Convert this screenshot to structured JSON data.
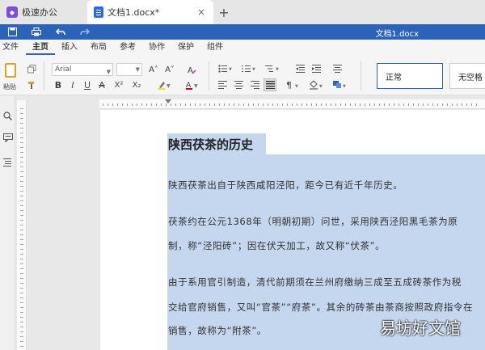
{
  "tabs": {
    "app_tab_label": "极速办公",
    "doc_tab_label": "文档1.docx*",
    "close_glyph": "×",
    "add_glyph": "+"
  },
  "quickbar": {
    "doc_title": "文档1.docx"
  },
  "menu": {
    "items": [
      "文件",
      "主页",
      "插入",
      "布局",
      "参考",
      "协作",
      "保护",
      "组件"
    ],
    "active": "主页"
  },
  "ribbon": {
    "paste_label": "粘贴",
    "font_name": "Arial",
    "grow_font": "A˄",
    "shrink_font": "A˅",
    "bold": "B",
    "italic": "I",
    "underline": "U",
    "strikethrough": "A",
    "superscript": "X²",
    "subscript": "X₂",
    "style_normal": "正常",
    "style_no_spacing": "无空格"
  },
  "document": {
    "heading": "陕西茯茶的历史",
    "lines": [
      "陕西茯茶出自于陕西咸阳泾阳，距今已有近千年历史。",
      "茯茶约在公元1368年（明朝初期）问世，采用陕西泾阳黑毛茶为原",
      "制，称“泾阳砖”；因在伏天加工，故又称“伏茶”。",
      "由于系用官引制造，清代前期须在兰州府缴纳三成至五成砖茶作为税",
      "交给官府销售，又叫“官茶”“府茶”。其余的砖茶由茶商按照政府指令在",
      "销售，故称为“附茶”。"
    ]
  },
  "watermark": "易坊好文馆"
}
